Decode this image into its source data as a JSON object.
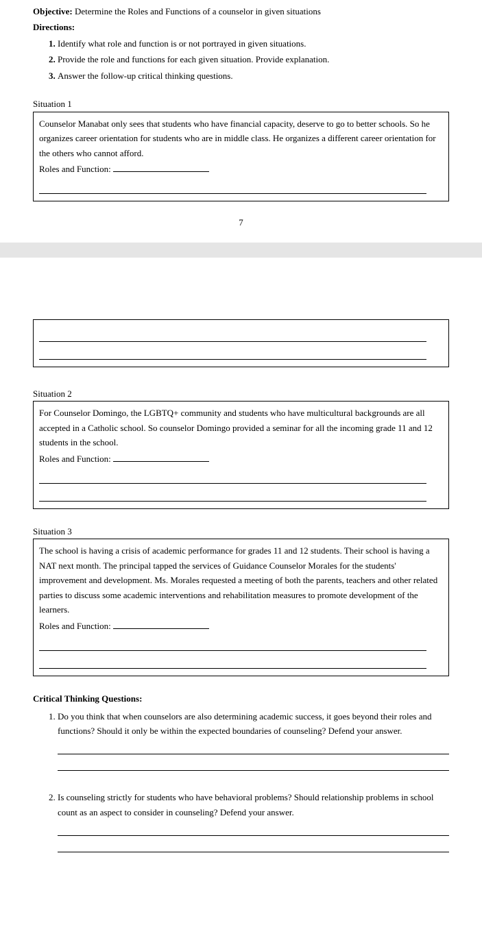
{
  "header": {
    "objectiveLabel": "Objective:",
    "objectiveText": " Determine the Roles and Functions of a counselor in given situations",
    "directionsLabel": "Directions:",
    "directions": [
      "Identify what role and function is or not portrayed in given situations.",
      "Provide the role and functions for each given situation. Provide explanation.",
      "Answer the follow-up critical thinking questions."
    ]
  },
  "situations": {
    "s1": {
      "title": "Situation 1",
      "text": "Counselor Manabat only sees that students who have financial capacity, deserve to go to better schools. So he organizes career orientation for students who are in middle class. He organizes a different career orientation for the others who cannot afford.",
      "rfLabel": "Roles and Function:"
    },
    "s2": {
      "title": "Situation 2",
      "text": "For Counselor Domingo, the LGBTQ+ community and students who have multicultural backgrounds are all accepted in a Catholic school. So counselor Domingo provided a seminar for all the incoming grade 11 and 12 students in the school.",
      "rfLabel": "Roles and Function:"
    },
    "s3": {
      "title": "Situation 3",
      "text": "The school is having a crisis of academic performance for grades 11 and 12 students. Their school is having a NAT next month. The principal tapped the services of Guidance Counselor Morales for the students' improvement and development. Ms. Morales requested a meeting of both the parents, teachers and other related parties to discuss some academic interventions and rehabilitation measures to promote development of the learners.",
      "rfLabel": "Roles and Function:"
    }
  },
  "pageNumber": "7",
  "ctq": {
    "heading": "Critical Thinking Questions:",
    "q1": "Do you think that when counselors are also determining academic success, it goes beyond their roles and functions? Should it only be within the expected boundaries of counseling? Defend your answer.",
    "q2": "Is counseling strictly for students who have behavioral problems? Should relationship problems in school count as an aspect to consider in counseling? Defend your answer."
  }
}
